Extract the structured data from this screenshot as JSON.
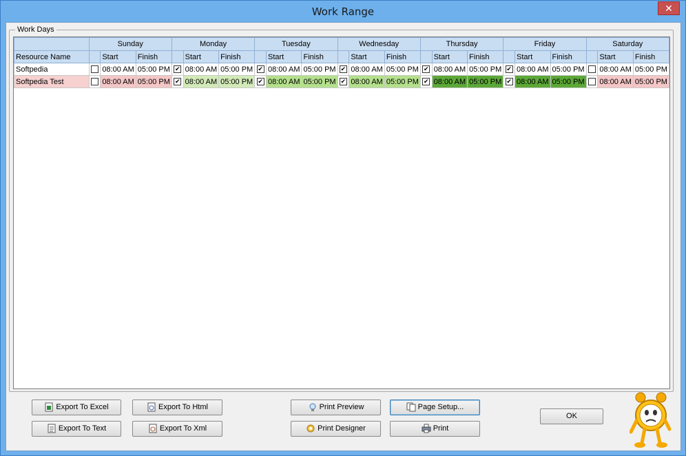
{
  "window": {
    "title": "Work Range",
    "close_label": "✕"
  },
  "group": {
    "label": "Work Days"
  },
  "grid": {
    "name_header": "Resource Name",
    "days": [
      {
        "day": "Sunday",
        "start_label": "Start",
        "finish_label": "Finish"
      },
      {
        "day": "Monday",
        "start_label": "Start",
        "finish_label": "Finish"
      },
      {
        "day": "Tuesday",
        "start_label": "Start",
        "finish_label": "Finish"
      },
      {
        "day": "Wednesday",
        "start_label": "Start",
        "finish_label": "Finish"
      },
      {
        "day": "Thursday",
        "start_label": "Start",
        "finish_label": "Finish"
      },
      {
        "day": "Friday",
        "start_label": "Start",
        "finish_label": "Finish"
      },
      {
        "day": "Saturday",
        "start_label": "Start",
        "finish_label": "Finish"
      }
    ],
    "rows": [
      {
        "name": "Softpedia",
        "cells": [
          {
            "checked": false,
            "start": "08:00 AM",
            "finish": "05:00 PM"
          },
          {
            "checked": true,
            "start": "08:00 AM",
            "finish": "05:00 PM"
          },
          {
            "checked": true,
            "start": "08:00 AM",
            "finish": "05:00 PM"
          },
          {
            "checked": true,
            "start": "08:00 AM",
            "finish": "05:00 PM"
          },
          {
            "checked": true,
            "start": "08:00 AM",
            "finish": "05:00 PM"
          },
          {
            "checked": true,
            "start": "08:00 AM",
            "finish": "05:00 PM"
          },
          {
            "checked": false,
            "start": "08:00 AM",
            "finish": "05:00 PM"
          }
        ]
      },
      {
        "name": "Softpedia Test",
        "cells": [
          {
            "checked": false,
            "start": "08:00 AM",
            "finish": "05:00 PM"
          },
          {
            "checked": true,
            "start": "08:00 AM",
            "finish": "05:00 PM"
          },
          {
            "checked": true,
            "start": "08:00 AM",
            "finish": "05:00 PM"
          },
          {
            "checked": true,
            "start": "08:00 AM",
            "finish": "05:00 PM"
          },
          {
            "checked": true,
            "start": "08:00 AM",
            "finish": "05:00 PM"
          },
          {
            "checked": true,
            "start": "08:00 AM",
            "finish": "05:00 PM"
          },
          {
            "checked": false,
            "start": "08:00 AM",
            "finish": "05:00 PM"
          }
        ]
      }
    ]
  },
  "buttons": {
    "export_excel": "Export To Excel",
    "export_html": "Export To Html",
    "export_text": "Export To Text",
    "export_xml": "Export To Xml",
    "print_preview": "Print Preview",
    "page_setup": "Page Setup...",
    "print_designer": "Print Designer",
    "print": "Print",
    "ok": "OK"
  },
  "colors": {
    "title_bar": "#6db0ec",
    "close_button": "#c75050",
    "header": "#c9ddf2",
    "off_day": "#f4c6c6",
    "light_green": "#d2eab8",
    "mid_green": "#b4e08c",
    "dark_green": "#5ca838"
  }
}
